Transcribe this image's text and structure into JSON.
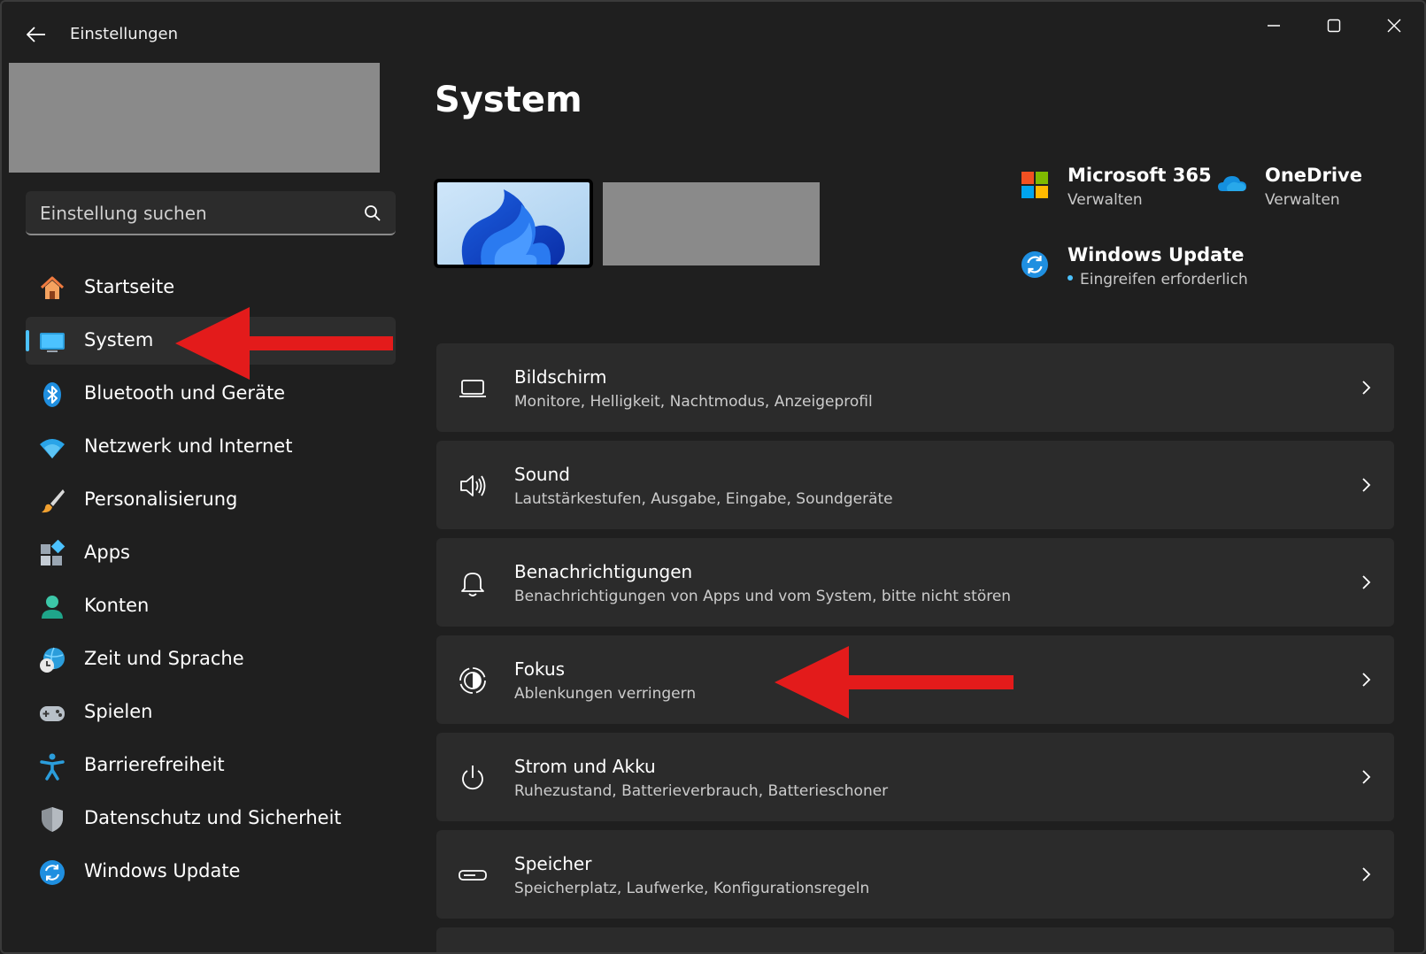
{
  "app": {
    "title": "Einstellungen",
    "window_controls": {
      "minimize": "minimize-icon",
      "maximize": "maximize-icon",
      "close": "close-icon"
    }
  },
  "sidebar": {
    "search_placeholder": "Einstellung suchen",
    "items": [
      {
        "label": "Startseite",
        "icon": "home-icon",
        "active": false
      },
      {
        "label": "System",
        "icon": "monitor-icon",
        "active": true
      },
      {
        "label": "Bluetooth und Geräte",
        "icon": "bluetooth-icon",
        "active": false
      },
      {
        "label": "Netzwerk und Internet",
        "icon": "wifi-icon",
        "active": false
      },
      {
        "label": "Personalisierung",
        "icon": "brush-icon",
        "active": false
      },
      {
        "label": "Apps",
        "icon": "apps-icon",
        "active": false
      },
      {
        "label": "Konten",
        "icon": "account-icon",
        "active": false
      },
      {
        "label": "Zeit und Sprache",
        "icon": "globe-clock-icon",
        "active": false
      },
      {
        "label": "Spielen",
        "icon": "gamepad-icon",
        "active": false
      },
      {
        "label": "Barrierefreiheit",
        "icon": "accessibility-icon",
        "active": false
      },
      {
        "label": "Datenschutz und Sicherheit",
        "icon": "shield-icon",
        "active": false
      },
      {
        "label": "Windows Update",
        "icon": "update-icon",
        "active": false
      }
    ]
  },
  "main": {
    "title": "System",
    "quick_links": [
      {
        "title": "Microsoft 365",
        "subtitle": "Verwalten",
        "icon": "microsoft-logo-icon"
      },
      {
        "title": "OneDrive",
        "subtitle": "Verwalten",
        "icon": "onedrive-icon"
      },
      {
        "title": "Windows Update",
        "subtitle": "Eingreifen erforderlich",
        "icon": "update-icon"
      }
    ],
    "cards": [
      {
        "title": "Bildschirm",
        "subtitle": "Monitore, Helligkeit, Nachtmodus, Anzeigeprofil",
        "icon": "laptop-icon"
      },
      {
        "title": "Sound",
        "subtitle": "Lautstärkestufen, Ausgabe, Eingabe, Soundgeräte",
        "icon": "speaker-icon"
      },
      {
        "title": "Benachrichtigungen",
        "subtitle": "Benachrichtigungen von Apps und vom System, bitte nicht stören",
        "icon": "bell-icon"
      },
      {
        "title": "Fokus",
        "subtitle": "Ablenkungen verringern",
        "icon": "focus-icon"
      },
      {
        "title": "Strom und Akku",
        "subtitle": "Ruhezustand, Batterieverbrauch, Batterieschoner",
        "icon": "power-icon"
      },
      {
        "title": "Speicher",
        "subtitle": "Speicherplatz, Laufwerke, Konfigurationsregeln",
        "icon": "storage-icon"
      }
    ]
  },
  "colors": {
    "accent": "#4cc2ff",
    "annotation_arrow": "#e31b1b",
    "background": "#1f1f1f",
    "card": "#2b2b2b"
  }
}
